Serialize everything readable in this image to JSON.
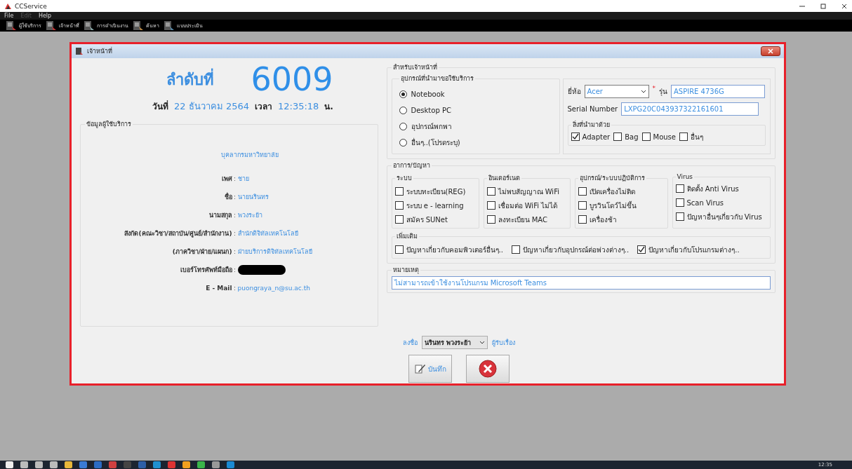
{
  "app": {
    "title": "CCService"
  },
  "menu": [
    {
      "label": "File",
      "disabled": false
    },
    {
      "label": "Edit",
      "disabled": true
    },
    {
      "label": "Help",
      "disabled": false
    }
  ],
  "toolbar": [
    {
      "label": "ผู้ใช้บริการ"
    },
    {
      "label": "เจ้าหน้าที่"
    },
    {
      "label": "การดำเนินงาน"
    },
    {
      "label": "ค้นหา"
    },
    {
      "label": "แบบประเมิน"
    }
  ],
  "dialog": {
    "title": "เจ้าหน้าที่",
    "queue_label": "ลำดับที่",
    "queue_number": "6009",
    "date_label": "วันที่",
    "date": "22 ธันวาคม 2564",
    "time_label": "เวลา",
    "time": "12:35:18",
    "time_unit": "น.",
    "user_info": {
      "title": "ข้อมูลผู้ใช้บริการ",
      "user_type": "บุคลากรมหาวิทยาลัย",
      "fields": [
        {
          "label": "เพศ",
          "separator": ":",
          "value": "ชาย",
          "kind": "text"
        },
        {
          "label": "ชื่อ",
          "separator": ":",
          "value": "นายนรินทร",
          "kind": "text"
        },
        {
          "label": "นามสกุล",
          "separator": ":",
          "value": "พวงระย้า",
          "kind": "text"
        },
        {
          "label": "สังกัด(คณะวิชา/สถาบัน/ศูนย์/สำนักงาน)",
          "separator": ":",
          "value": "สำนักดิจิทัลเทคโนโลยี",
          "kind": "text"
        },
        {
          "label": "(ภาควิชา/ฝ่าย/แผนก)",
          "separator": ":",
          "value": "ฝ่ายบริการดิจิทัลเทคโนโลยี",
          "kind": "text"
        },
        {
          "label": "เบอร์โทรศัพท์มือถือ",
          "separator": ":",
          "kind": "redacted"
        },
        {
          "label": "E - Mail",
          "separator": ":",
          "value": "puongraya_n@su.ac.th",
          "kind": "text"
        }
      ]
    },
    "staff": {
      "title": "สำหรับเจ้าหน้าที่",
      "device": {
        "title": "อุปกรณ์ที่นำมาขอใช้บริการ",
        "options": [
          {
            "label": "Notebook",
            "selected": true
          },
          {
            "label": "Desktop PC",
            "selected": false
          },
          {
            "label": "อุปกรณ์พกพา",
            "selected": false
          },
          {
            "label": "อื่นๆ..(โปรดระบุ)",
            "selected": false
          }
        ]
      },
      "brand": {
        "label": "ยี่ห้อ",
        "value": "Acer",
        "required_mark": "*"
      },
      "model": {
        "label": "รุ่น",
        "value": "ASPIRE 4736G"
      },
      "serial": {
        "label": "Serial Number",
        "value": "LXPG20C043937322161601"
      },
      "accessories": {
        "title": "สิ่งที่นำมาด้วย",
        "items": [
          {
            "label": "Adapter",
            "checked": true
          },
          {
            "label": "Bag",
            "checked": false
          },
          {
            "label": "Mouse",
            "checked": false
          },
          {
            "label": "อื่นๆ",
            "checked": false
          }
        ]
      }
    },
    "problems": {
      "title": "อาการ/ปัญหา",
      "groups": [
        {
          "title": "ระบบ",
          "items": [
            {
              "label": "ระบบทะเบียน(REG)",
              "checked": false
            },
            {
              "label": "ระบบ e - learning",
              "checked": false
            },
            {
              "label": "สมัคร SUNet",
              "checked": false
            }
          ]
        },
        {
          "title": "อินเตอร์เนต",
          "items": [
            {
              "label": "ไม่พบสัญญาณ WiFi",
              "checked": false
            },
            {
              "label": "เชื่อมต่อ WiFi ไม่ได้",
              "checked": false
            },
            {
              "label": "ลงทะเบียน MAC",
              "checked": false
            }
          ]
        },
        {
          "title": "อุปกรณ์/ระบบปฏิบัติการ",
          "items": [
            {
              "label": "เปิดเครื่องไม่ติด",
              "checked": false
            },
            {
              "label": "บูรวินโดว์ไม่ขึ้น",
              "checked": false
            },
            {
              "label": "เครื่องช้า",
              "checked": false
            }
          ]
        },
        {
          "title": "Virus",
          "items": [
            {
              "label": "ติดตั้ง Anti Virus",
              "checked": false
            },
            {
              "label": "Scan Virus",
              "checked": false
            },
            {
              "label": "ปัญหาอื่นๆเกี่ยวกับ Virus",
              "checked": false
            }
          ]
        }
      ],
      "extra": {
        "title": "เพิ่มเติม",
        "items": [
          {
            "label": "ปัญหาเกี่ยวกับคอมพิวเตอร์อื่นๆ..",
            "checked": false
          },
          {
            "label": "ปัญหาเกี่ยวกับอุปกรณ์ต่อพ่วงต่างๆ..",
            "checked": false
          },
          {
            "label": "ปัญหาเกี่ยวกับโปรแกรมต่างๆ..",
            "checked": true
          }
        ]
      }
    },
    "note": {
      "title": "หมายเหตุ",
      "value": "ไม่สามารถเข้าใช้งานโปรแกรม Microsoft Teams"
    },
    "signature": {
      "label": "ลงชื่อ",
      "value": "นรินทร พวงระย้า",
      "role": "ผู้รับเรื่อง"
    },
    "buttons": [
      {
        "kind": "save",
        "label": "บันทึก"
      },
      {
        "kind": "cancel"
      }
    ]
  },
  "taskbar": {
    "clock": "12:35"
  }
}
